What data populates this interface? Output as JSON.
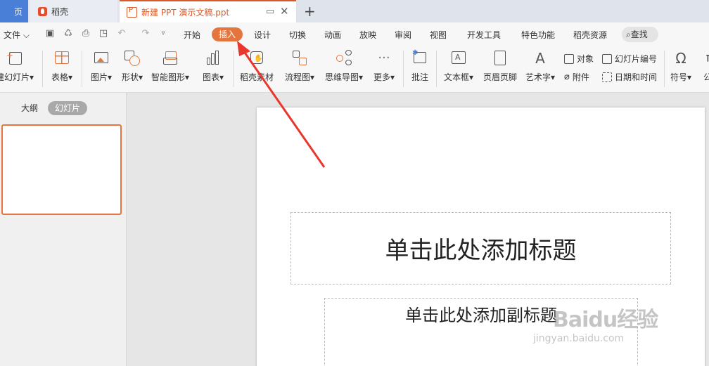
{
  "tabs": {
    "home": "页",
    "daoke": "稻壳",
    "doc": "新建 PPT 演示文稿.ppt"
  },
  "menu": {
    "file": "文件",
    "items": [
      "开始",
      "插入",
      "设计",
      "切换",
      "动画",
      "放映",
      "审阅",
      "视图",
      "开发工具",
      "特色功能",
      "稻壳资源"
    ],
    "search": "查找",
    "active": "插入",
    "active_color": "#e5753e"
  },
  "ribbon": {
    "new_slide": "建幻灯片",
    "table": "表格",
    "picture": "图片",
    "shape": "形状",
    "smart_art": "智能图形",
    "chart": "图表",
    "material": "稻壳素材",
    "flowchart": "流程图",
    "mindmap": "思维导图",
    "more": "更多",
    "comment": "批注",
    "textbox": "文本框",
    "header_footer": "页眉页脚",
    "wordart": "艺术字",
    "object": "对象",
    "attachment": "附件",
    "slide_number": "幻灯片编号",
    "datetime": "日期和时间",
    "symbol": "符号",
    "formula": "公"
  },
  "pane": {
    "outline": "大纲",
    "slides": "幻灯片"
  },
  "slide": {
    "title_placeholder": "单击此处添加标题",
    "subtitle_placeholder": "单击此处添加副标题"
  },
  "watermark": {
    "main": "Baidu经验",
    "sub": "jingyan.baidu.com"
  },
  "colors": {
    "accent": "#e5753e",
    "arrow": "#e8372d"
  }
}
